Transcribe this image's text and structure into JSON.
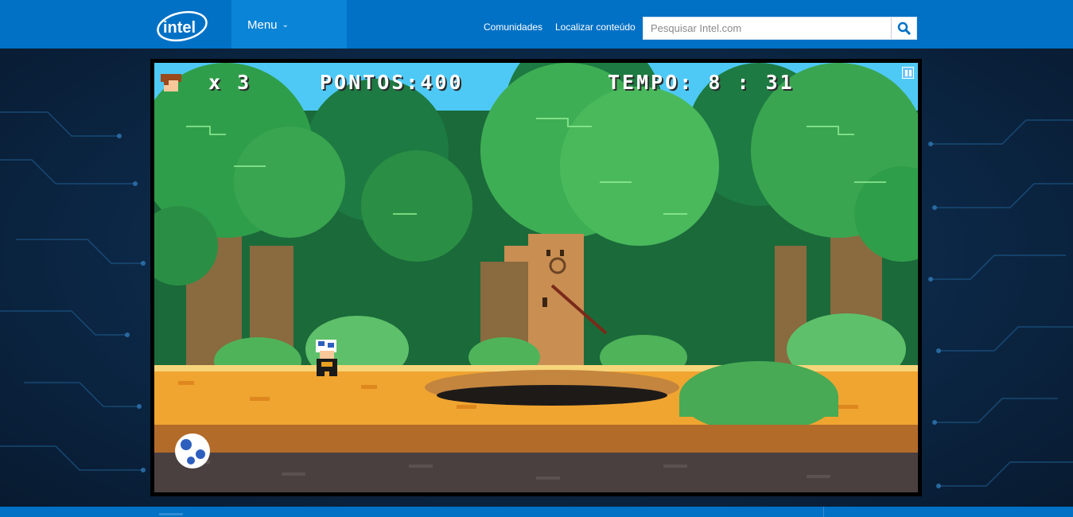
{
  "header": {
    "logo_text": "intel",
    "menu_label": "Menu",
    "links": [
      "Comunidades",
      "Localizar conteúdo"
    ],
    "search_placeholder": "Pesquisar Intel.com"
  },
  "game": {
    "lives_prefix": "x",
    "lives": "3",
    "score_label": "PONTOS:",
    "score": "400",
    "time_label": "TEMPO:",
    "time": "8 : 31"
  },
  "colors": {
    "brand_blue": "#0071c5",
    "menu_blue": "#0a84d6",
    "sky": "#4ec9f5",
    "ground": "#f0a530"
  },
  "icons": [
    "search-icon",
    "chevron-down-icon",
    "pause-icon",
    "player-life-icon"
  ]
}
